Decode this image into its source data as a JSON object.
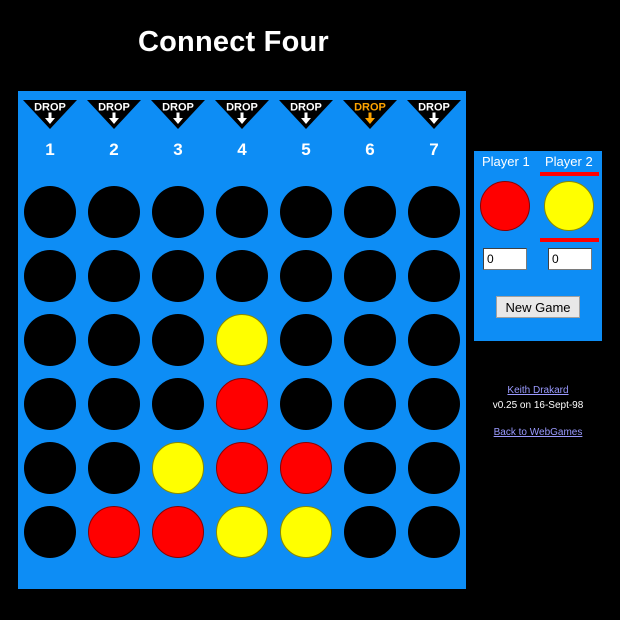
{
  "title": "Connect Four",
  "columns": [
    {
      "drop_label": "DROP",
      "number": "1",
      "highlighted": false
    },
    {
      "drop_label": "DROP",
      "number": "2",
      "highlighted": false
    },
    {
      "drop_label": "DROP",
      "number": "3",
      "highlighted": false
    },
    {
      "drop_label": "DROP",
      "number": "4",
      "highlighted": false
    },
    {
      "drop_label": "DROP",
      "number": "5",
      "highlighted": false
    },
    {
      "drop_label": "DROP",
      "number": "6",
      "highlighted": true
    },
    {
      "drop_label": "DROP",
      "number": "7",
      "highlighted": false
    }
  ],
  "board": [
    [
      "empty",
      "empty",
      "empty",
      "empty",
      "empty",
      "empty",
      "empty"
    ],
    [
      "empty",
      "empty",
      "empty",
      "empty",
      "empty",
      "empty",
      "empty"
    ],
    [
      "empty",
      "empty",
      "empty",
      "yellow",
      "empty",
      "empty",
      "empty"
    ],
    [
      "empty",
      "empty",
      "empty",
      "red",
      "empty",
      "empty",
      "empty"
    ],
    [
      "empty",
      "empty",
      "yellow",
      "red",
      "red",
      "empty",
      "empty"
    ],
    [
      "empty",
      "red",
      "red",
      "yellow",
      "yellow",
      "empty",
      "empty"
    ]
  ],
  "players": {
    "p1": {
      "name": "Player 1",
      "color": "red",
      "score": "0"
    },
    "p2": {
      "name": "Player 2",
      "color": "yellow",
      "score": "0"
    },
    "current_turn": "p2"
  },
  "controls": {
    "new_game_label": "New Game"
  },
  "credits": {
    "author": "Keith Drakard",
    "version": "v0.25 on 16-Sept-98",
    "back_link": "Back to WebGames"
  },
  "colors": {
    "board": "#0d8df5",
    "red": "#ff0000",
    "yellow": "#ffff00",
    "empty": "#000000",
    "drop_highlight": "#ffa500",
    "turn_indicator": "#ff0000",
    "link": "#9a9aff"
  }
}
